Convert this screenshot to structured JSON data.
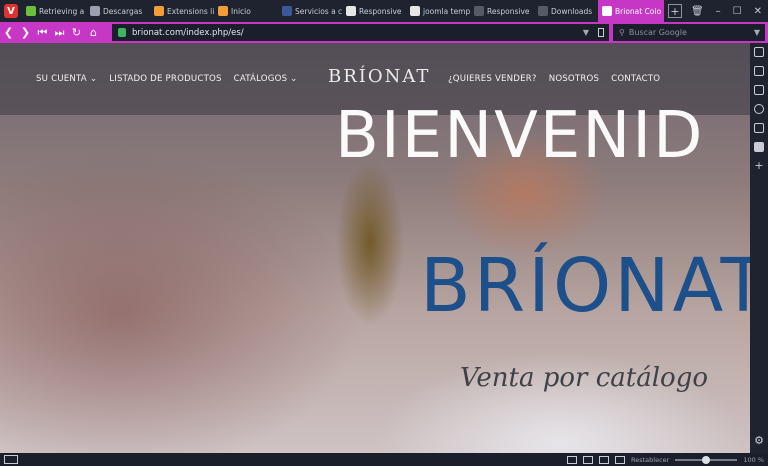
{
  "tabs": [
    {
      "label": "Retrieving a",
      "icon": "green-globe-icon",
      "color": "#6bbf3a"
    },
    {
      "label": "Descargas",
      "icon": "download-icon",
      "color": "#9aa0b0"
    },
    {
      "label": "Extensions li",
      "icon": "joomla-icon",
      "color": "#f29d38"
    },
    {
      "label": "Inicio",
      "icon": "joomla-icon",
      "color": "#f29d38"
    },
    {
      "label": "Servicios a co",
      "icon": "facebook-icon",
      "color": "#3b5998"
    },
    {
      "label": "Responsive",
      "icon": "github-icon",
      "color": "#e6e6e6"
    },
    {
      "label": "joomla temp",
      "icon": "github-icon",
      "color": "#e6e6e6"
    },
    {
      "label": "Responsive",
      "icon": "mountain-icon",
      "color": "#555a66"
    },
    {
      "label": "Downloads",
      "icon": "mountain-icon",
      "color": "#555a66"
    },
    {
      "label": "Brionat Colo",
      "icon": "page-icon",
      "color": "#ffffff",
      "active": true
    }
  ],
  "address": {
    "url": "brionat.com/index.php/es/",
    "search_placeholder": "Buscar Google"
  },
  "site": {
    "nav_left": [
      "SU CUENTA ⌄",
      "LISTADO DE PRODUCTOS",
      "CATÁLOGOS ⌄"
    ],
    "logo_small": "BRÍONAT",
    "nav_right": [
      "¿QUIERES VENDER?",
      "NOSOTROS",
      "CONTACTO"
    ],
    "hero_title": "BIENVENID",
    "brand": "BRÍONAT",
    "tagline": "Venta por catálogo"
  },
  "status": {
    "reset_label": "Restablecer",
    "zoom": "100 %",
    "zoom_fraction": 0.5
  },
  "colors": {
    "accent": "#c637c6",
    "brand_blue": "#1d4f8a"
  }
}
